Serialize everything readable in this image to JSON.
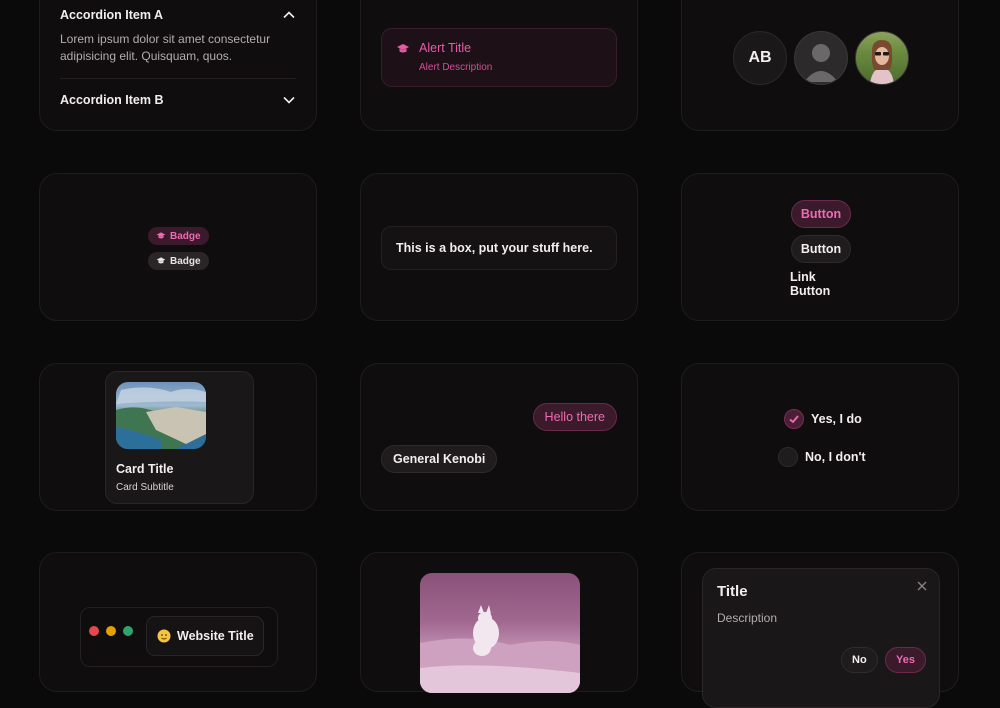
{
  "accordion": {
    "item_a": {
      "title": "Accordion Item A",
      "body": "Lorem ipsum dolor sit amet consectetur adipisicing elit. Quisquam, quos.",
      "expanded": true
    },
    "item_b": {
      "title": "Accordion Item B",
      "expanded": false
    }
  },
  "alert": {
    "title": "Alert Title",
    "description": "Alert Description",
    "icon": "graduation-cap-icon"
  },
  "avatars": {
    "initials": "AB",
    "generic_icon": "person-icon",
    "photo": "user-photo"
  },
  "badges": [
    {
      "label": "Badge",
      "variant": "primary",
      "icon": "graduation-cap-icon"
    },
    {
      "label": "Badge",
      "variant": "secondary",
      "icon": "graduation-cap-icon"
    }
  ],
  "box": {
    "text": "This is a box, put your stuff here."
  },
  "buttons": {
    "primary": "Button",
    "secondary": "Button",
    "link": "Link Button"
  },
  "card": {
    "title": "Card Title",
    "subtitle": "Card Subtitle"
  },
  "chat": {
    "outgoing": "Hello there",
    "incoming": "General Kenobi"
  },
  "radio": {
    "options": [
      {
        "label": "Yes, I do",
        "checked": true
      },
      {
        "label": "No, I don't",
        "checked": false
      }
    ]
  },
  "window": {
    "tab_title": "Website Title",
    "tab_icon": "emoji-icon",
    "traffic_lights": [
      "#e5484d",
      "#e5a000",
      "#30a46c"
    ]
  },
  "image": {
    "alt": "arctic-fox-photo"
  },
  "dialog": {
    "title": "Title",
    "description": "Description",
    "cancel": "No",
    "confirm": "Yes"
  },
  "colors": {
    "accent": "#e85aa8",
    "background": "#0b0a0a",
    "card": "#0f0d0e"
  }
}
